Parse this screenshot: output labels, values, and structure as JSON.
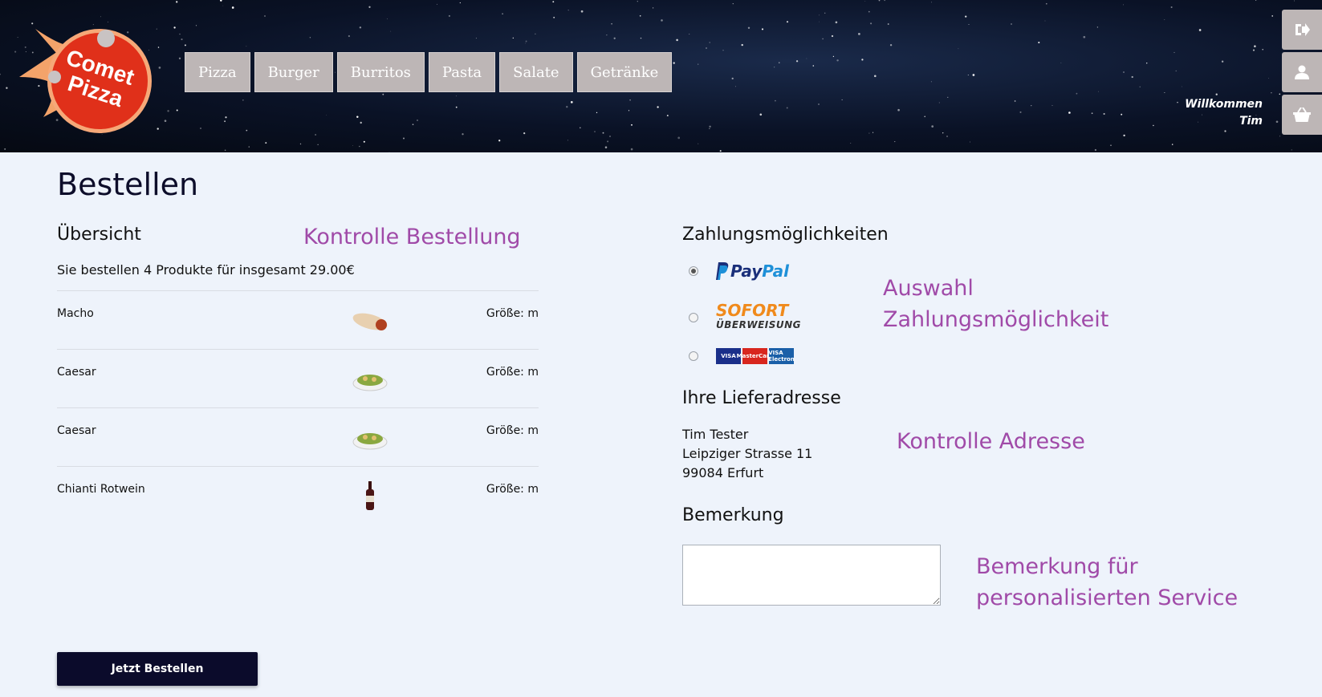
{
  "nav": [
    "Pizza",
    "Burger",
    "Burritos",
    "Pasta",
    "Salate",
    "Getränke"
  ],
  "welcome": {
    "line1": "Willkommen",
    "line2": "Tim"
  },
  "logo": {
    "line1": "Comet",
    "line2": "Pizza"
  },
  "page": {
    "title": "Bestellen"
  },
  "overview": {
    "heading": "Übersicht",
    "summary": "Sie bestellen 4 Produkte für insgesamt 29.00€",
    "items": [
      {
        "name": "Macho",
        "size": "Größe: m",
        "icon": "burrito-image"
      },
      {
        "name": "Caesar",
        "size": "Größe: m",
        "icon": "salad-image"
      },
      {
        "name": "Caesar",
        "size": "Größe: m",
        "icon": "salad-image"
      },
      {
        "name": "Chianti Rotwein",
        "size": "Größe: m",
        "icon": "wine-bottle-image"
      }
    ]
  },
  "payment": {
    "heading": "Zahlungsmöglichkeiten",
    "options": [
      {
        "label": "PayPal",
        "selected": true
      },
      {
        "label": "SOFORT ÜBERWEISUNG",
        "selected": false
      },
      {
        "label": "VISA / MasterCard / VISA Electron",
        "selected": false
      }
    ],
    "paypal_a": "Pay",
    "paypal_b": "Pal",
    "sofort_a": "SOFORT",
    "sofort_b": "ÜBERWEISUNG",
    "cards": [
      "VISA",
      "MasterCard",
      "VISA Electron"
    ]
  },
  "address": {
    "heading": "Ihre Lieferadresse",
    "name": "Tim Tester",
    "street": "Leipziger Strasse 11",
    "city": "99084 Erfurt"
  },
  "remark": {
    "heading": "Bemerkung",
    "value": ""
  },
  "order_button": "Jetzt Bestellen",
  "annotations": {
    "order": "Kontrolle Bestellung",
    "payment_1": "Auswahl",
    "payment_2": "Zahlungsmöglichkeit",
    "address": "Kontrolle Adresse",
    "remark_1": "Bemerkung für",
    "remark_2": "personalisierten Service"
  },
  "colors": {
    "accent": "#a04aa8",
    "nav_bg": "#bdb6b6",
    "button_bg": "#0b0b2b",
    "logo_red": "#e0301a"
  }
}
